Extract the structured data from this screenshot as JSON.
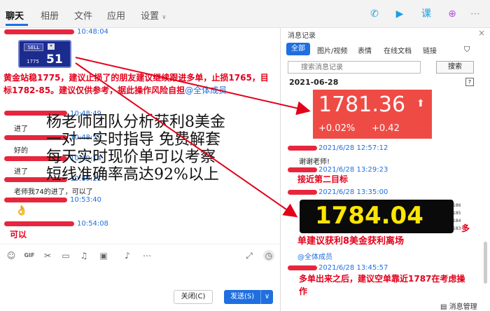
{
  "tabs": {
    "chat": "聊天",
    "album": "相册",
    "file": "文件",
    "app": "应用",
    "settings": "设置",
    "settings_arrow": "∨"
  },
  "top_icons": {
    "call": "phone-icon",
    "video": "video-icon",
    "class": "class-icon",
    "add": "add-icon"
  },
  "colors": {
    "accent": "#1f6fe0",
    "red": "#e3001b",
    "quote_red": "#ef4b45"
  },
  "chat": {
    "times": [
      "10:48:04",
      "10:48:49",
      "10:48:59",
      "10:49:14",
      "10:49:21",
      "10:53:40",
      "10:54:08"
    ],
    "sell_widget": {
      "label": "SELL",
      "small": "1775",
      "big": "51"
    },
    "post_red": "黄金站稳1775，建议止损了的朋友建议继续跟进多单，止损1765，目标1782-85。建议仅供参考，据此操作风险自担",
    "mention": "@全体成员",
    "replies": [
      "进了",
      "好的",
      "进了",
      "老师我74的进了，可以了"
    ],
    "final_red": "可以",
    "overlay": [
      "杨老师团队分析获利8美金",
      "一对一实时指导  免费解套",
      "每天实时现价单可以考察",
      "短线准确率高达92%以上"
    ]
  },
  "toolbar": {
    "icons": [
      "emoji-icon",
      "gif-icon",
      "scissors-icon",
      "folder-icon",
      "music-icon",
      "image-icon",
      "bell-icon",
      "more-icon"
    ],
    "expand_icon": "expand-icon",
    "history_icon": "clock-icon"
  },
  "buttons": {
    "close": "关闭(C)",
    "send": "发送(S)",
    "send_arrow": "∨"
  },
  "panel": {
    "title": "消息记录",
    "close": "×",
    "filters": [
      "全部",
      "图片/视频",
      "表情",
      "在线文档",
      "链接"
    ],
    "filter_icon": "filter-icon",
    "search_placeholder": "搜索消息记录",
    "search_button": "搜索",
    "date": "2021-06-28",
    "calendar": "7",
    "quote": {
      "price": "1781.36",
      "pct": "+0.02%",
      "change": "+0.42"
    },
    "entries": [
      {
        "time": "2021/6/28 12:57:12",
        "text": "谢谢老师!"
      },
      {
        "time": "2021/6/28 13:29:23",
        "text": "接近第二目标"
      },
      {
        "time": "2021/6/28 13:35:00",
        "text": ""
      }
    ],
    "big_quote": {
      "price": "1784.04",
      "ticks": [
        "186",
        "185",
        "184",
        "183"
      ]
    },
    "side_note": "多",
    "profit_text": "单建议获利8美金获利离场",
    "mention": "@全体成员",
    "last_time": "2021/6/28 13:45:57",
    "last_text": "多单出来之后，建议空单靠近1787在考虑操作",
    "manage": "消息管理"
  }
}
